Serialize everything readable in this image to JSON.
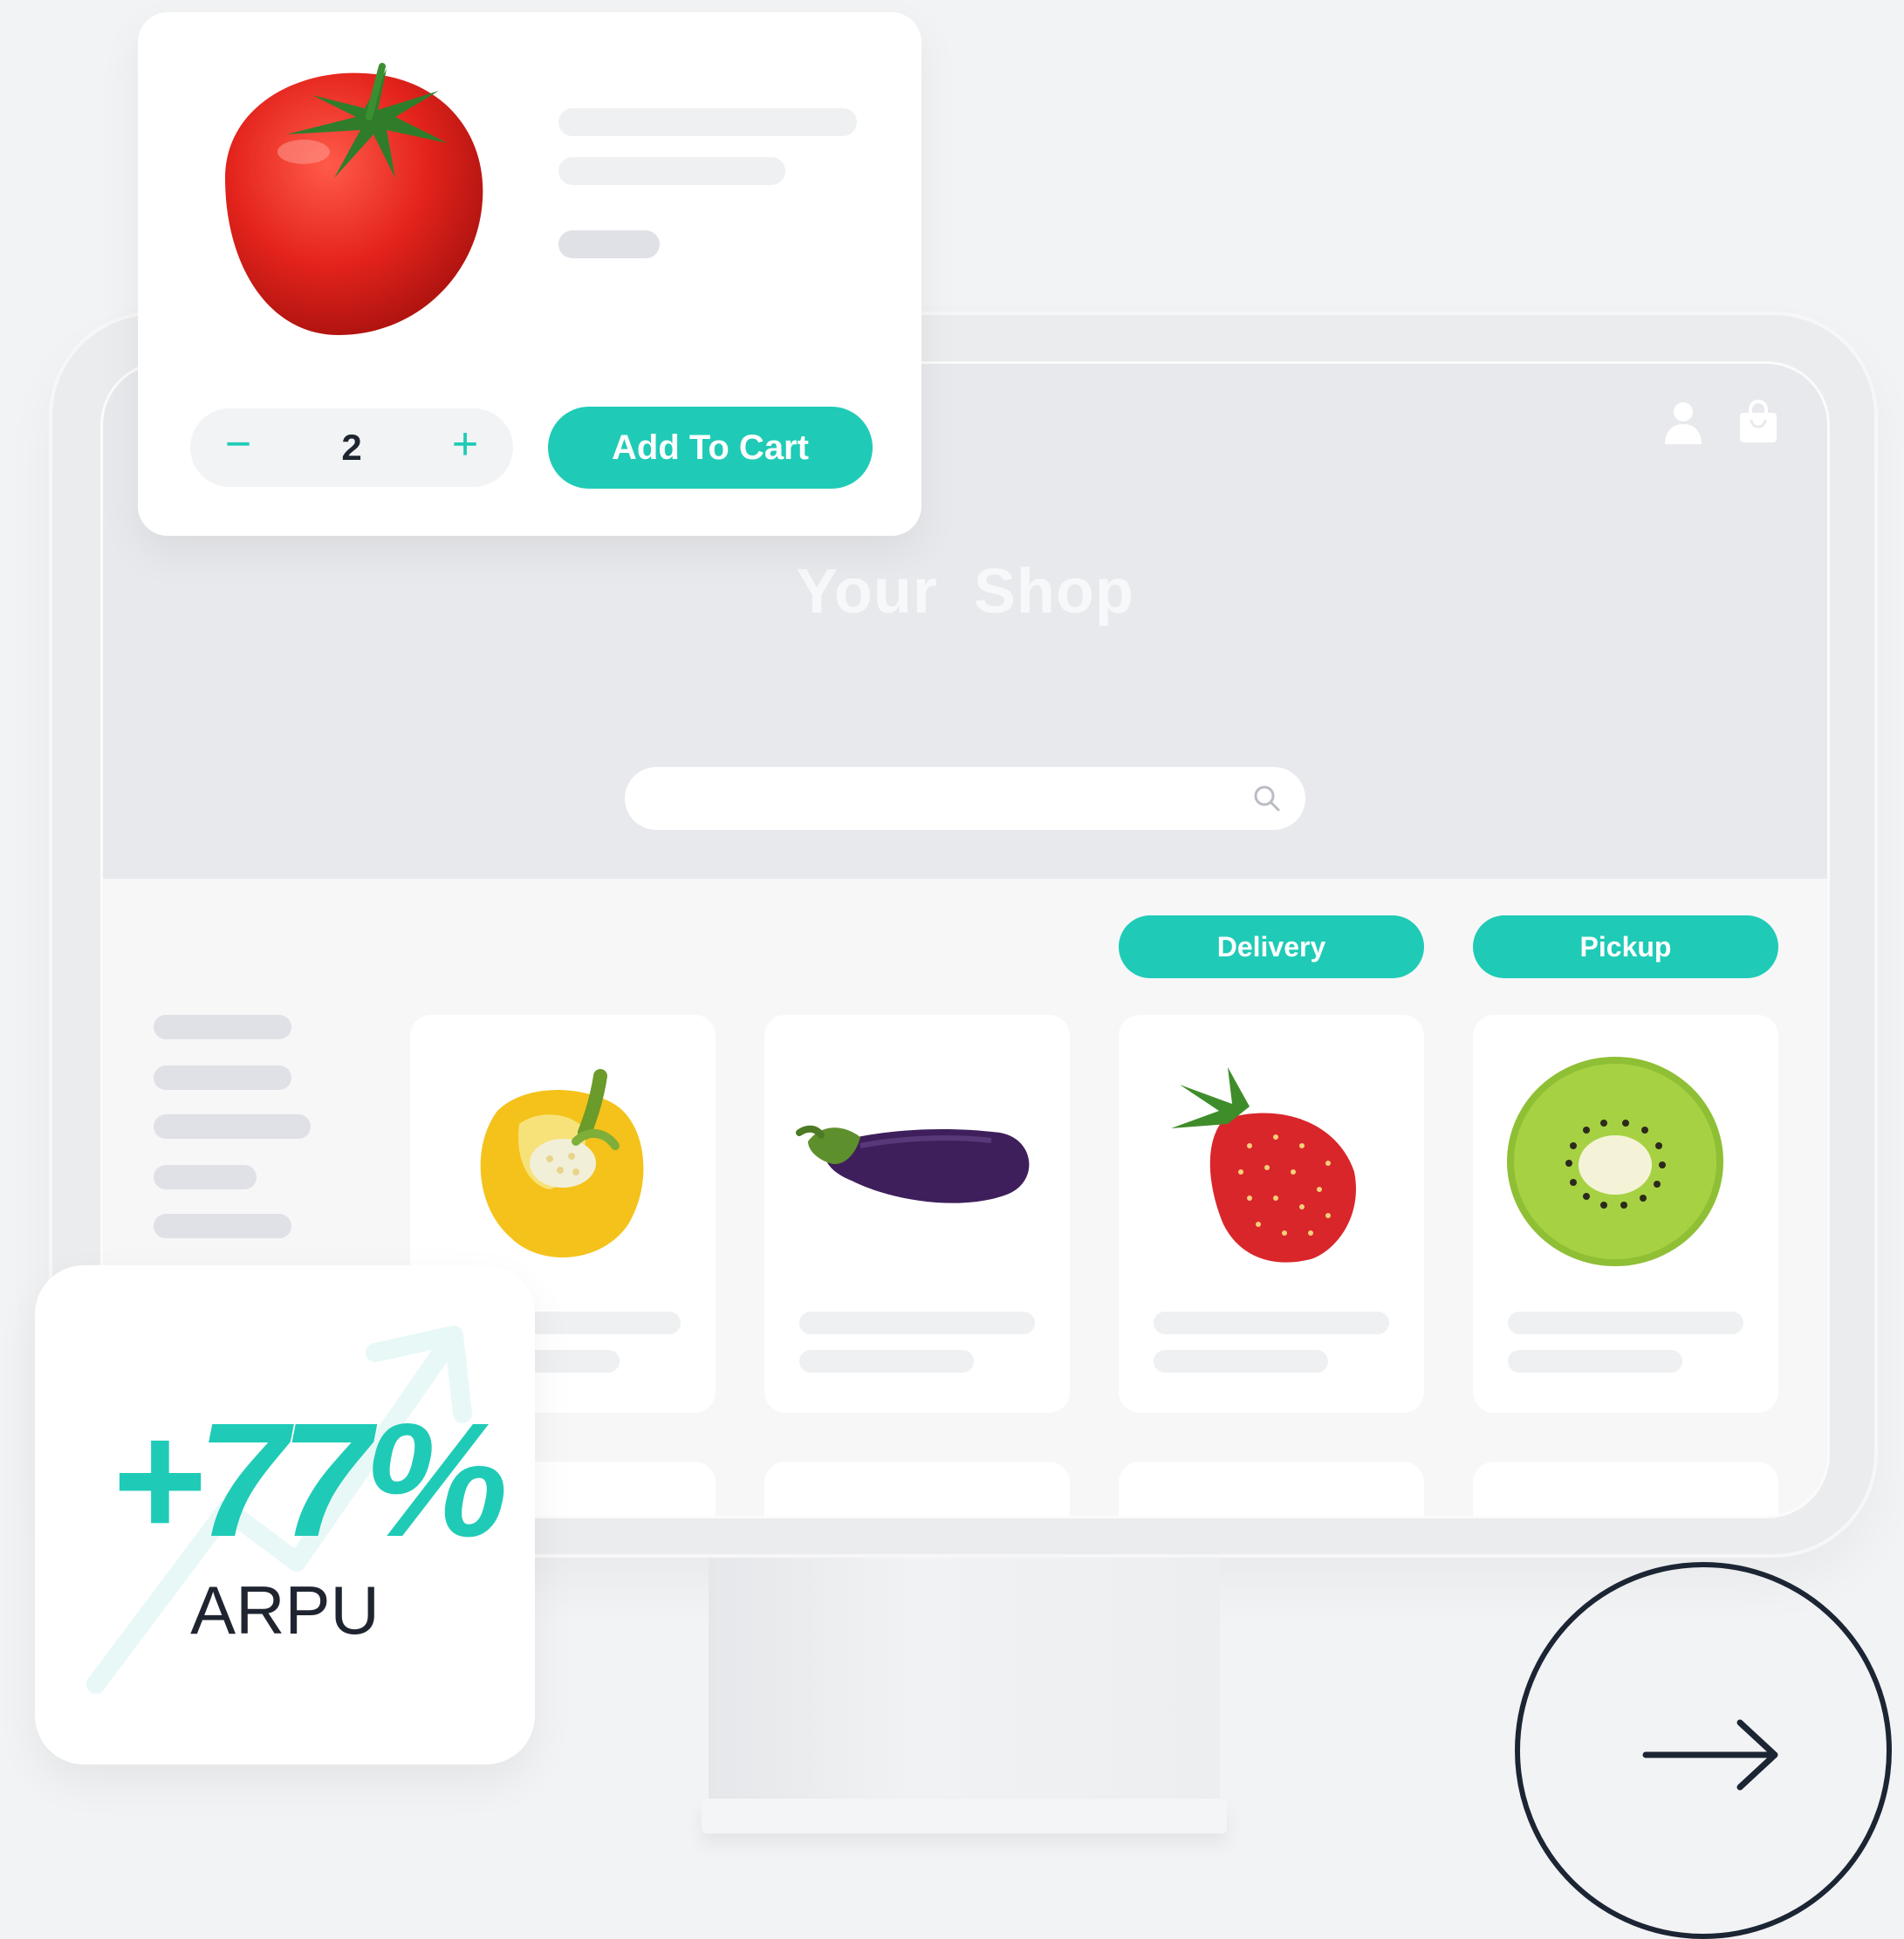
{
  "colors": {
    "accent": "#1fcbb6",
    "background": "#f2f3f5",
    "hero": "#e8e9ec",
    "text_dark": "#1f2530"
  },
  "shop": {
    "title": "Your Shop",
    "search_placeholder": ""
  },
  "header_icons": [
    "user-icon",
    "shopping-bag-icon"
  ],
  "filters": {
    "delivery_label": "Delivery",
    "pickup_label": "Pickup"
  },
  "products": [
    {
      "name": "yellow-pepper",
      "icon": "pepper-icon"
    },
    {
      "name": "eggplant",
      "icon": "eggplant-icon"
    },
    {
      "name": "strawberry",
      "icon": "strawberry-icon"
    },
    {
      "name": "kiwi",
      "icon": "kiwi-icon"
    }
  ],
  "product_popup": {
    "image_icon": "tomato-icon",
    "quantity": "2",
    "minus_label": "−",
    "plus_label": "+",
    "add_to_cart_label": "Add To Cart"
  },
  "stat": {
    "value": "+77%",
    "label": "ARPU"
  },
  "cta": {
    "icon": "arrow-right-icon"
  }
}
